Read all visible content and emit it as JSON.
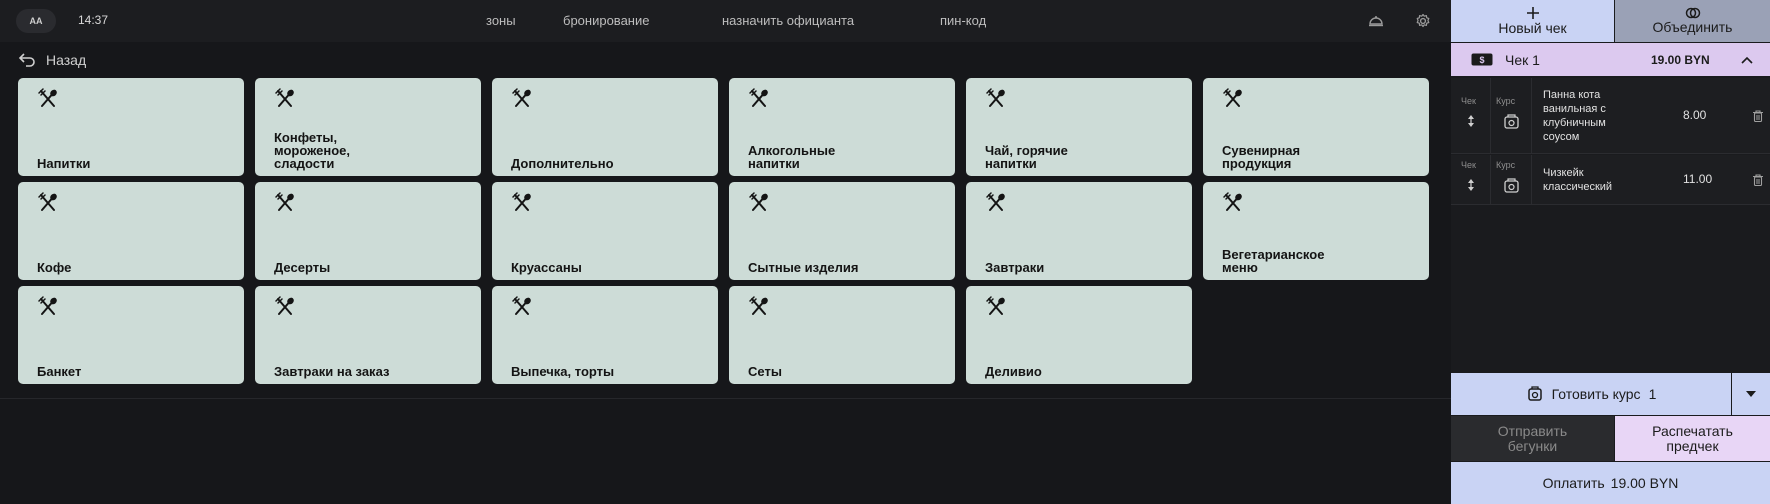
{
  "header": {
    "avatar": "АА",
    "time": "14:37",
    "nav": [
      "зоны",
      "бронирование",
      "назначить официанта",
      "пин-код"
    ]
  },
  "back_label": "Назад",
  "categories": [
    "Напитки",
    "Конфеты,\nмороженое,\nсладости",
    "Дополнительно",
    "Алкогольные\nнапитки",
    "Чай, горячие\nнапитки",
    "Сувенирная\nпродукция",
    "Кофе",
    "Десерты",
    "Круассаны",
    "Сытные изделия",
    "Завтраки",
    "Вегетарианское\nменю",
    "Банкет",
    "Завтраки на заказ",
    "Выпечка, торты",
    "Сеты",
    "Деливио"
  ],
  "panel": {
    "new_check": "Новый чек",
    "merge": "Объединить",
    "check_title": "Чек 1",
    "check_total": "19.00 BYN",
    "col_check": "Чек",
    "col_course": "Курс",
    "items": [
      {
        "name": "Панна кота\nванильная с\nклубничным\nсоусом",
        "price": "8.00"
      },
      {
        "name": "Чизкейк\nклассический",
        "price": "11.00"
      }
    ],
    "prepare_label": "Готовить курс",
    "prepare_course": "1",
    "send_runners": "Отправить\nбегунки",
    "print_precheck": "Распечатать\nпредчек",
    "pay_label": "Оплатить",
    "pay_amount": "19.00 BYN"
  },
  "colors": {
    "tile": "#cddcd7",
    "accent_blue": "#c9d3f4",
    "accent_violet": "#dcc9ef",
    "background": "#16171a"
  },
  "icons": {
    "tile": "fork-knife-icon",
    "back": "back-arrow-icon",
    "delete": "trash-icon",
    "course": "course-icon",
    "settings": "gear-icon",
    "waiter": "cloche-icon"
  }
}
